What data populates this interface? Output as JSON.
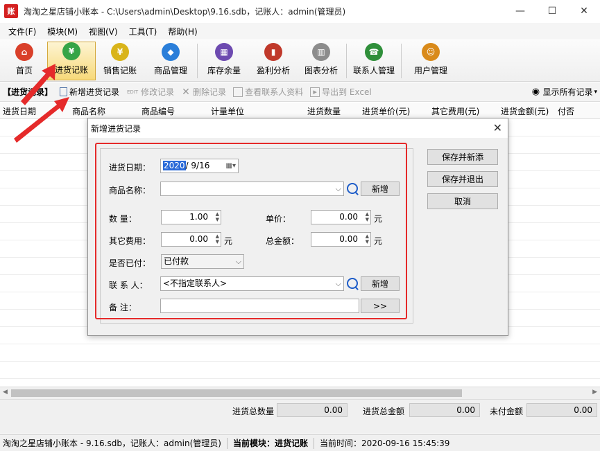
{
  "window": {
    "title": "淘淘之星店铺小账本 - C:\\Users\\admin\\Desktop\\9.16.sdb，记账人：admin(管理员)",
    "app_icon_text": "账",
    "minimize": "—",
    "maximize": "☐",
    "close": "✕"
  },
  "menu": [
    "文件(F)",
    "模块(M)",
    "视图(V)",
    "工具(T)",
    "帮助(H)"
  ],
  "toolbar": {
    "items": [
      {
        "label": "首页",
        "icon": "home-icon",
        "color": "#d9402a"
      },
      {
        "label": "进货记账",
        "icon": "purchase-icon",
        "color": "#36a447"
      },
      {
        "label": "销售记账",
        "icon": "sales-icon",
        "color": "#d9b41a"
      },
      {
        "label": "商品管理",
        "icon": "goods-icon",
        "color": "#2a7ed9"
      },
      {
        "label": "库存余量",
        "icon": "stock-icon",
        "color": "#6d4ab0"
      },
      {
        "label": "盈利分析",
        "icon": "profit-icon",
        "color": "#c0392b"
      },
      {
        "label": "图表分析",
        "icon": "chart-icon",
        "color": "#8c8c8c"
      },
      {
        "label": "联系人管理",
        "icon": "contacts-icon",
        "color": "#2f8f3a"
      },
      {
        "label": "用户管理",
        "icon": "users-icon",
        "color": "#d98a1a"
      }
    ]
  },
  "subbar": {
    "section": "【进货记录】",
    "new": "新增进货记录",
    "edit_tag": "EDIT",
    "edit": "修改记录",
    "delete": "删除记录",
    "view_contact": "查看联系人资料",
    "export": "导出到 Excel",
    "show_all": "显示所有记录"
  },
  "columns": [
    "进货日期",
    "商品名称",
    "商品编号",
    "计量单位",
    "进货数量",
    "进货单价(元)",
    "其它费用(元)",
    "进货金额(元)",
    "付否"
  ],
  "summary": {
    "qty_label": "进货总数量",
    "qty_value": "0.00",
    "amount_label": "进货总金额",
    "amount_value": "0.00",
    "unpaid_label": "未付金额",
    "unpaid_value": "0.00"
  },
  "status": {
    "app": "淘淘之星店铺小账本 - 9.16.sdb，记账人：admin(管理员)",
    "module_label": "当前模块：进货记账",
    "time": "当前时间：2020-09-16 15:45:39"
  },
  "dialog": {
    "title": "新增进货记录",
    "date_label": "进货日期：",
    "date_year": "2020",
    "date_rest": "/  9/16",
    "goods_label": "商品名称：",
    "goods_value": "",
    "new_btn": "新增",
    "qty_label": "数    量：",
    "qty_value": "1.00",
    "price_label": "单价：",
    "price_value": "0.00",
    "unit_yuan": "元",
    "fee_label": "其它费用：",
    "fee_value": "0.00",
    "total_label": "总金额：",
    "total_value": "0.00",
    "paid_label": "是否已付：",
    "paid_value": "已付款",
    "contact_label": "联  系  人：",
    "contact_value": "<不指定联系人>",
    "note_label": "备    注：",
    "note_value": "",
    "more_btn": ">>",
    "save_new": "保存并新添",
    "save_exit": "保存并退出",
    "cancel": "取消"
  },
  "colors": {
    "highlight_red": "#e52a2a",
    "active_tab": "#f7d97a"
  }
}
